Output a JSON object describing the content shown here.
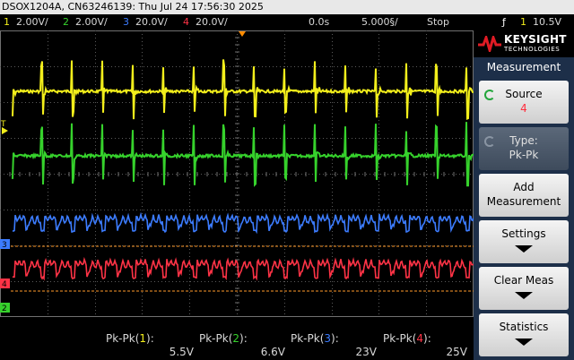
{
  "status_line": "DSOX1204A, CN63246139: Thu Jul 24 17:56:30 2025",
  "channels": [
    {
      "num": "1",
      "scale": "2.00V/",
      "color": "#f2ee1b"
    },
    {
      "num": "2",
      "scale": "2.00V/",
      "color": "#36d22c"
    },
    {
      "num": "3",
      "scale": "20.0V/",
      "color": "#3c7cff"
    },
    {
      "num": "4",
      "scale": "20.0V/",
      "color": "#ff3346"
    }
  ],
  "timebase": {
    "delay": "0.0s",
    "scale": "5.000§/",
    "run_state": "Stop",
    "trigger_level": "10.5V",
    "trigger_symbol": "ƒ",
    "trigger_channel": "1"
  },
  "markers": {
    "trigger": "T",
    "ch3": "3",
    "ch4": "4",
    "ch2": "2"
  },
  "panel": {
    "brand": "KEYSIGHT",
    "brand_sub": "TECHNOLOGIES",
    "menu_title": "Measurement",
    "softkeys": [
      {
        "line1": "Source",
        "line2": "4"
      },
      {
        "line1": "Type:",
        "line2": "Pk-Pk"
      },
      {
        "line1": "Add",
        "line2": "Measurement"
      },
      {
        "line1": "Settings"
      },
      {
        "line1": "Clear Meas"
      },
      {
        "line1": "Statistics"
      }
    ]
  },
  "measurements": [
    {
      "label_pre": "Pk-Pk(",
      "ch": "1",
      "label_post": "):",
      "value": "5.5V"
    },
    {
      "label_pre": "Pk-Pk(",
      "ch": "2",
      "label_post": "):",
      "value": "6.6V"
    },
    {
      "label_pre": "Pk-Pk(",
      "ch": "3",
      "label_post": "):",
      "value": "23V"
    },
    {
      "label_pre": "Pk-Pk(",
      "ch": "4",
      "label_post": "):",
      "value": "25V"
    }
  ]
}
